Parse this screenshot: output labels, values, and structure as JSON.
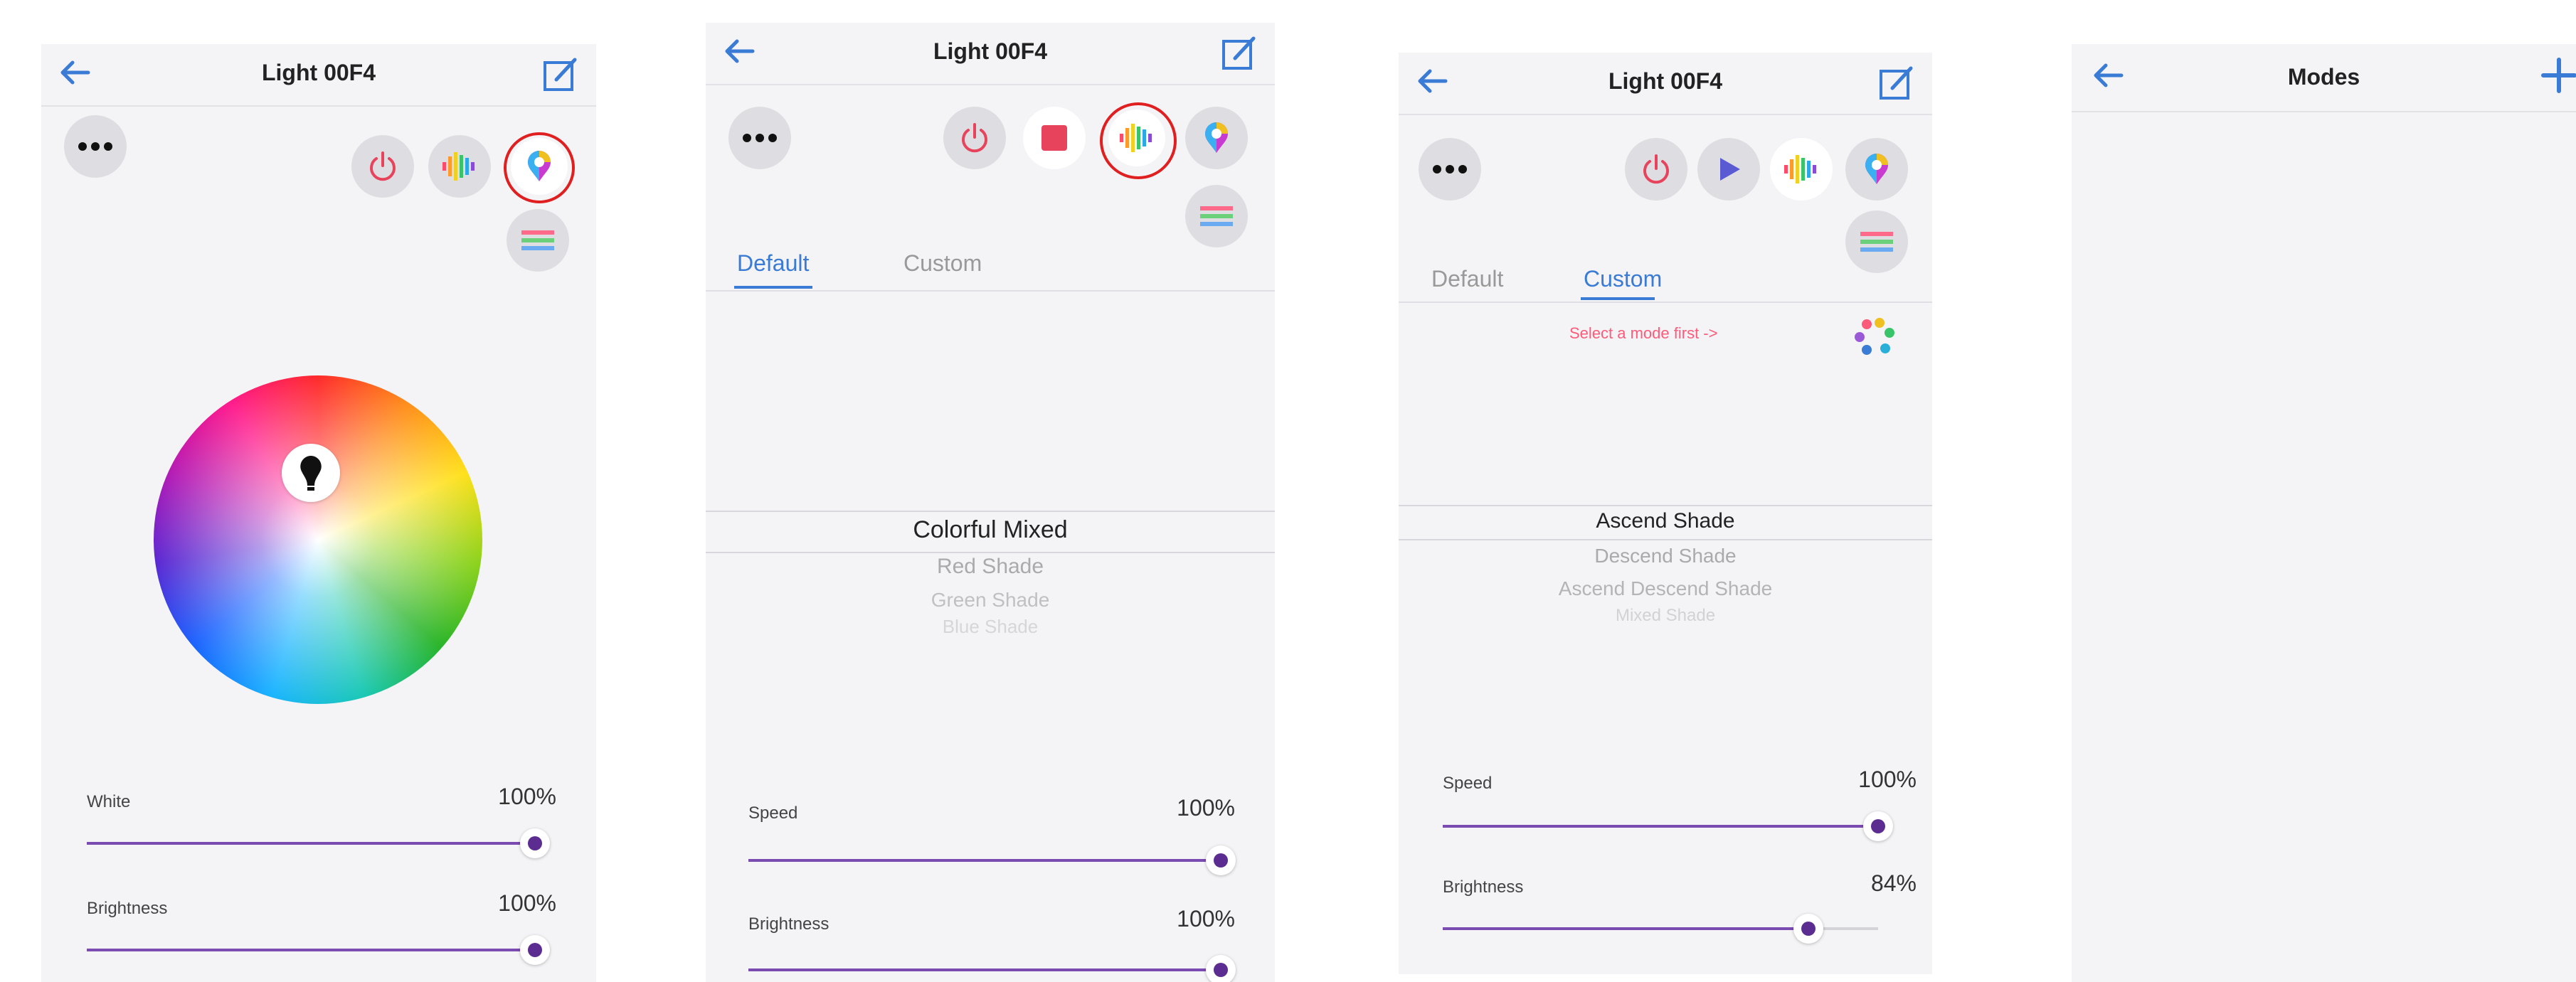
{
  "screen1": {
    "title": "Light 00F4",
    "sliders": [
      {
        "label": "White",
        "value_text": "100%",
        "level": 1.0
      },
      {
        "label": "Brightness",
        "value_text": "100%",
        "level": 1.0
      }
    ]
  },
  "screen2": {
    "title": "Light 00F4",
    "tabs": [
      "Default",
      "Custom"
    ],
    "active_tab": "Default",
    "modes": [
      "Colorful Mixed",
      "Red Shade",
      "Green Shade",
      "Blue Shade"
    ],
    "selected_mode": "Colorful Mixed",
    "sliders": [
      {
        "label": "Speed",
        "value_text": "100%",
        "level": 1.0
      },
      {
        "label": "Brightness",
        "value_text": "100%",
        "level": 1.0
      }
    ]
  },
  "screen3": {
    "title": "Light 00F4",
    "tabs": [
      "Default",
      "Custom"
    ],
    "active_tab": "Custom",
    "hint": "Select a mode first ->",
    "modes": [
      "Ascend Shade",
      "Descend Shade",
      "Ascend Descend Shade",
      "Mixed Shade"
    ],
    "selected_mode": "Ascend Shade",
    "sliders": [
      {
        "label": "Speed",
        "value_text": "100%",
        "level": 1.0
      },
      {
        "label": "Brightness",
        "value_text": "84%",
        "level": 0.84
      }
    ]
  },
  "screen4": {
    "title": "Modes"
  },
  "colors": {
    "accent_blue": "#3a7bd5",
    "slider_purple": "#5b2d91",
    "stop_red": "#e8435c",
    "play_blue": "#5a5ad2",
    "highlight_ring": "#e02020",
    "hint_pink": "#ff5a7a"
  },
  "icons": [
    "back-arrow-icon",
    "edit-icon",
    "more-icon",
    "power-icon",
    "stop-icon",
    "play-icon",
    "music-mode-icon",
    "color-picker-icon",
    "segments-icon",
    "palette-icon",
    "bulb-marker-icon",
    "plus-icon"
  ]
}
